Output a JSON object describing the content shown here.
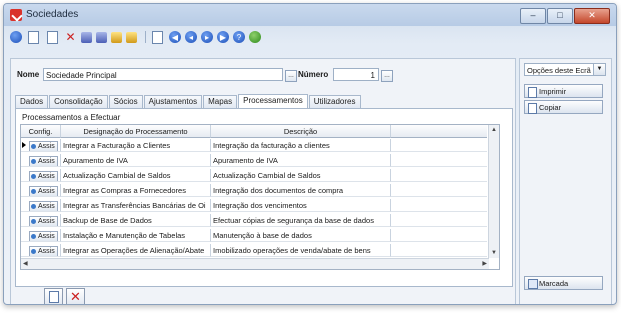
{
  "window": {
    "title": "Sociedades",
    "min": "–",
    "max": "□",
    "close": "✕"
  },
  "form": {
    "name_label": "Nome",
    "name_value": "Sociedade Principal",
    "number_label": "Número",
    "number_value": "1",
    "lookup_btn": "…"
  },
  "tabs": [
    "Dados",
    "Consolidação",
    "Sócios",
    "Ajustamentos",
    "Mapas",
    "Processamentos",
    "Utilizadores"
  ],
  "active_tab": "Processamentos",
  "panel": {
    "group_title": "Processamentos a Efectuar",
    "columns": [
      "Config.",
      "Designação do Processamento",
      "Descrição"
    ],
    "assis_label": "Assis",
    "rows": [
      {
        "designacao": "Integrar a Facturação a Clientes",
        "descricao": "Integração da facturação a clientes"
      },
      {
        "designacao": "Apuramento de IVA",
        "descricao": "Apuramento de IVA"
      },
      {
        "designacao": "Actualização Cambial de Saldos",
        "descricao": "Actualização Cambial de Saldos"
      },
      {
        "designacao": "Integrar as Compras a Fornecedores",
        "descricao": "Integração dos documentos de compra"
      },
      {
        "designacao": "Integrar as Transferências Bancárias de Oi",
        "descricao": "Integração dos vencimentos"
      },
      {
        "designacao": "Backup de Base de Dados",
        "descricao": "Efectuar cópias de segurança da base de dados"
      },
      {
        "designacao": "Instalação e Manutenção de Tabelas",
        "descricao": "Manutenção à base de dados"
      },
      {
        "designacao": "Integrar as Operações de Alienação/Abate",
        "descricao": "Imobilizado operações de venda/abate de bens"
      }
    ]
  },
  "side": {
    "options_label": "Opções deste Ecrã",
    "print": "Imprimir",
    "copy": "Copiar",
    "marked": "Marcada"
  },
  "colors": {
    "title_red": "#d9322a",
    "close_red": "#c4472b",
    "delete_red": "#cc2020"
  }
}
